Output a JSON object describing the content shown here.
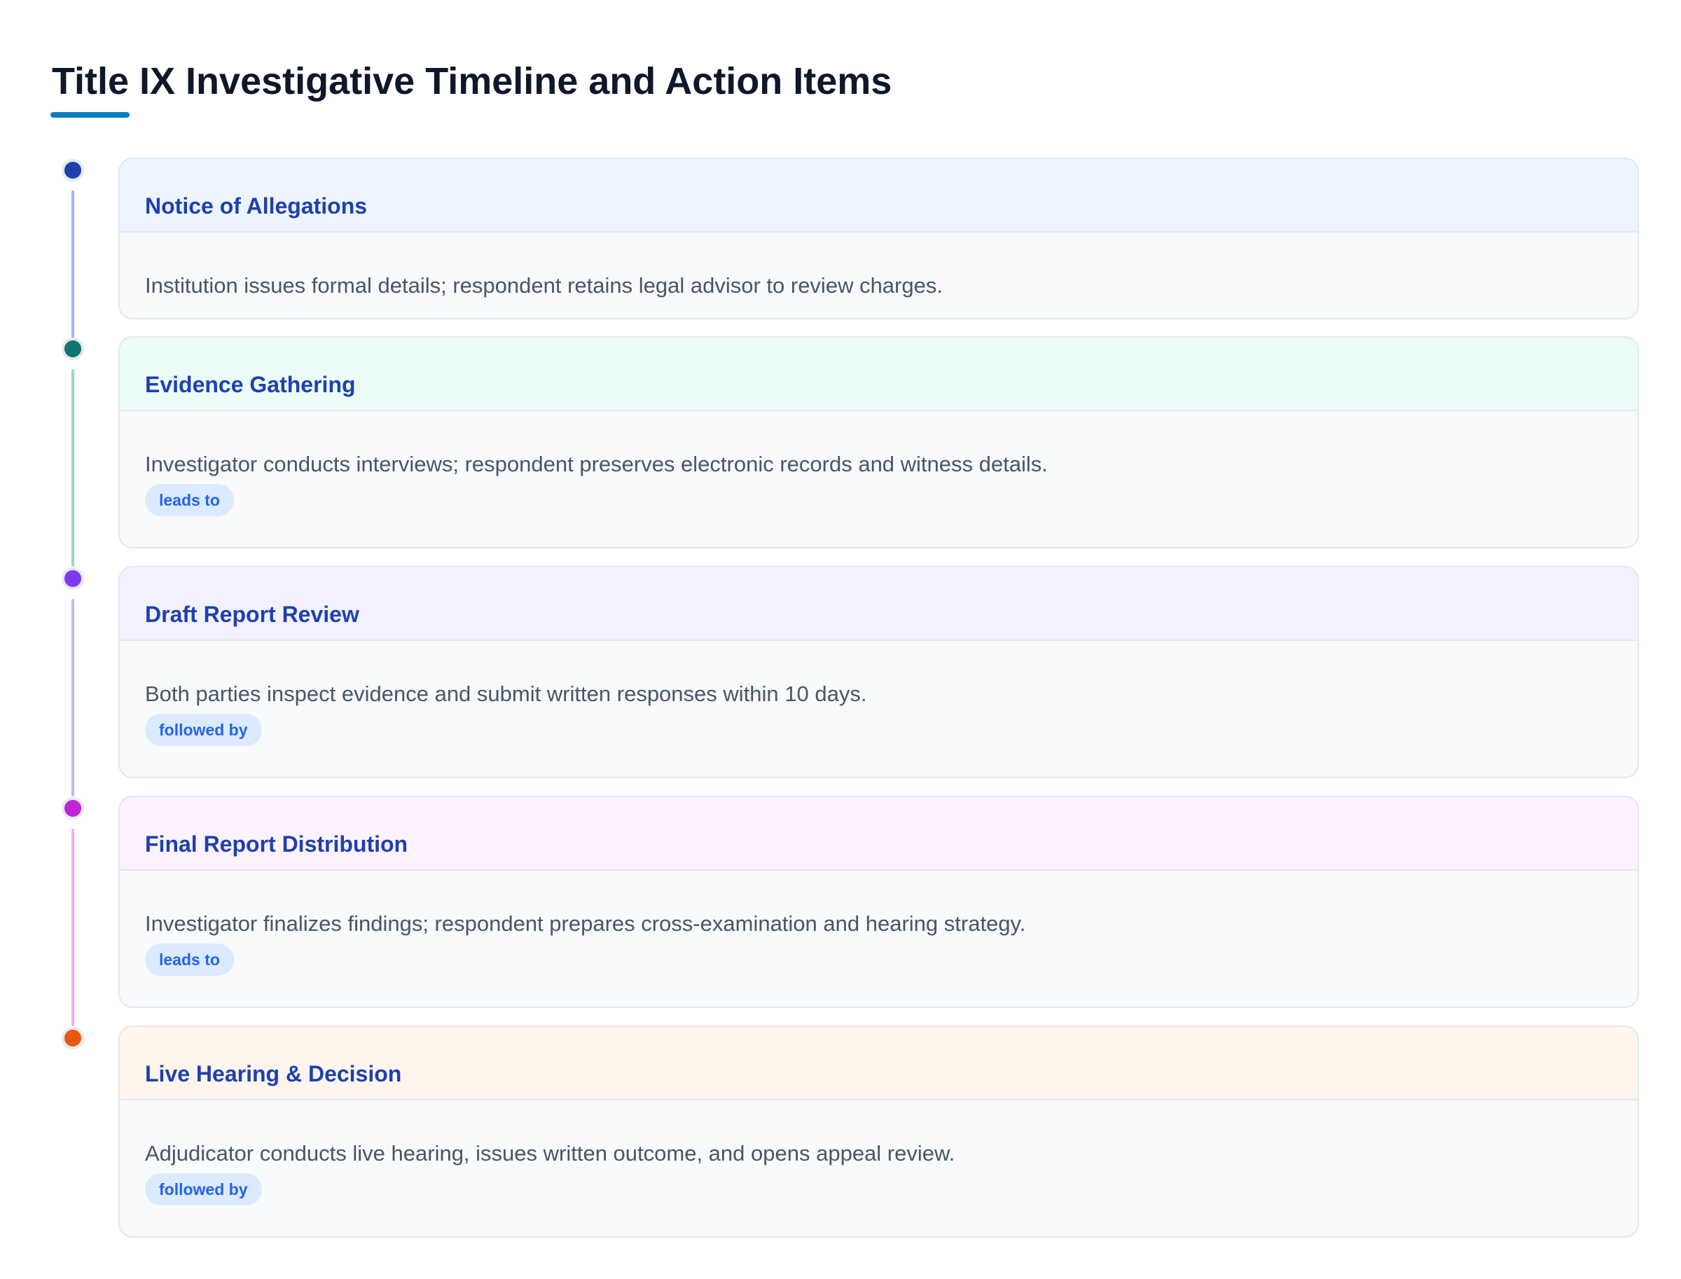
{
  "title": "Title IX Investigative Timeline and Action Items",
  "accent_color": "#0a7cc4",
  "steps": [
    {
      "title": "Notice of Allegations",
      "description": "Institution issues formal details; respondent retains legal advisor to review charges.",
      "badge": "",
      "dot_color": "#1e40af",
      "header_color": "#eef5fe",
      "connector_color": "#a5b4fc"
    },
    {
      "title": "Evidence Gathering",
      "description": "Investigator conducts interviews; respondent preserves electronic records and witness details.",
      "badge": "leads to",
      "dot_color": "#0f766e",
      "header_color": "#ecfdf8",
      "connector_color": "#99d6cc"
    },
    {
      "title": "Draft Report Review",
      "description": "Both parties inspect evidence and submit written responses within 10 days.",
      "badge": "followed by",
      "dot_color": "#7c3aed",
      "header_color": "#f3f1fe",
      "connector_color": "#c4b5fd"
    },
    {
      "title": "Final Report Distribution",
      "description": "Investigator finalizes findings; respondent prepares cross-examination and hearing strategy.",
      "badge": "leads to",
      "dot_color": "#c026d3",
      "header_color": "#fdf2fd",
      "connector_color": "#f0abfc"
    },
    {
      "title": "Live Hearing & Decision",
      "description": "Adjudicator conducts live hearing, issues written outcome, and opens appeal review.",
      "badge": "followed by",
      "dot_color": "#ea580c",
      "header_color": "#fff5ec",
      "connector_color": ""
    }
  ]
}
